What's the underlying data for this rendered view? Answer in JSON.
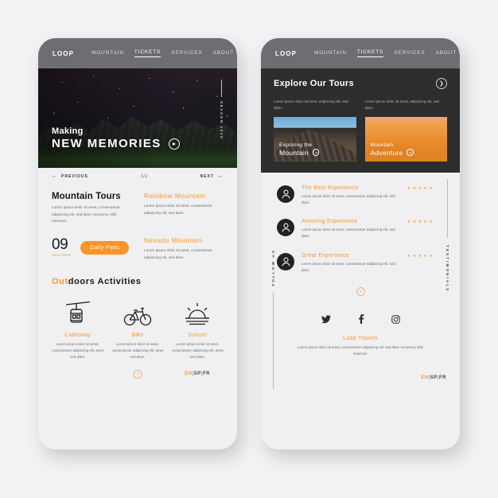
{
  "colors": {
    "accent": "#f5962c",
    "pill": "#fa9428",
    "navbar": "#6e6e72",
    "dark_section": "#2e2d2d",
    "page_bg": "#f0f0f2"
  },
  "screen_a": {
    "nav": {
      "brand": "LOOP",
      "links": [
        {
          "label": "MOUNTAIN",
          "active": false
        },
        {
          "label": "TICKETS",
          "active": true
        },
        {
          "label": "SERVICES",
          "active": false
        },
        {
          "label": "ABOUT US",
          "active": false
        }
      ]
    },
    "hero": {
      "eyebrow": "Making",
      "title": "NEW MEMORIES",
      "side_label": "SEASON 2020",
      "play_icon": "play-icon"
    },
    "slider": {
      "prev": "PREVIOUS",
      "count": "1/2",
      "next": "NEXT"
    },
    "tours": {
      "heading": "Mountain Tours",
      "paragraph": "Lorem ipsum dolor sit amet, consectetuer adipiscing elit, sed diam nonummy nibh euismod.",
      "items": [
        {
          "title": "Rainbow Mountain",
          "paragraph": "Lorem ipsum dolor sit amet, consectetuer adipiscing elit, sed diam."
        },
        {
          "title": "Nevado Mountain",
          "paragraph": "Lorem ipsum dolor sit amet, consectetuer adipiscing elit, sed diam."
        }
      ],
      "date_day": "09",
      "date_month": "June 2020",
      "pass_label": "Daily Pass"
    },
    "activities": {
      "heading_accent": "Out",
      "heading_rest": "doors  Activities",
      "items": [
        {
          "icon": "cableway-icon",
          "name": "Cableway",
          "paragraph": "Lorem ipsum dolor sit amet, consectetuer adipiscing elit, amet sed diam."
        },
        {
          "icon": "bike-icon",
          "name": "Bike",
          "paragraph": "Lorem ipsum dolor sit amet, consectetuer adipiscing elit, amet sed diam."
        },
        {
          "icon": "sunset-icon",
          "name": "Sunset",
          "paragraph": "Lorem ipsum dolor sit amet, consectetuer adipiscing elit, amet sed diam."
        }
      ]
    },
    "footer": {
      "scroll_icon": "chevron-down-circle-icon",
      "lang_active": "EN",
      "lang_second": "SP",
      "lang_third": "FR",
      "sep": "|"
    }
  },
  "screen_b": {
    "nav": {
      "brand": "LOOP",
      "links": [
        {
          "label": "MOUNTAIN",
          "active": false
        },
        {
          "label": "TICKETS",
          "active": true
        },
        {
          "label": "SERVICES",
          "active": false
        },
        {
          "label": "ABOUT US",
          "active": false
        }
      ]
    },
    "explore": {
      "title": "Explore Our Tours",
      "next_icon": "chevron-right-circle-icon",
      "cards": [
        {
          "paragraph": "Lorem ipsum dolor sit amet, adipiscing elit, sed diam.",
          "cap_line1": "Exploring the",
          "cap_line2": "Mountain",
          "tinted": false
        },
        {
          "paragraph": "Lorem ipsum dolor sit amet, adipiscing elit, sed diam.",
          "cap_line1": "Mountain",
          "cap_line2": "Adventure",
          "tinted": true
        }
      ]
    },
    "testimonials": {
      "rail_label": "TESTIMONIALS",
      "items": [
        {
          "avatar": "user-icon",
          "title": "The Best Experience",
          "paragraph": "Lorem ipsum dolor sit amet, consectetuer adipiscing elit, sed diam.",
          "stars": 5
        },
        {
          "avatar": "user-icon",
          "title": "Amazing Experience",
          "paragraph": "Lorem ipsum dolor sit amet, consectetuer adipiscing elit, sed diam.",
          "stars": 5
        },
        {
          "avatar": "user-icon",
          "title": "Great Experience",
          "paragraph": "Lorem ipsum dolor sit amet, consectetuer adipiscing elit, sed diam.",
          "stars": 5
        }
      ]
    },
    "follow": {
      "rail_label": "FOLLOW US",
      "scroll_icon": "chevron-down-circle-icon",
      "socials": [
        "twitter-icon",
        "facebook-icon",
        "instagram-icon"
      ]
    },
    "footer": {
      "brand": "Loop Travels",
      "paragraph": "Lorem ipsum dolor sit amet, consectetuer adipiscing elit, sed diam nonummy nibh euismod.",
      "lang_active": "EN",
      "lang_second": "SP",
      "lang_third": "FR",
      "sep": "|"
    }
  }
}
